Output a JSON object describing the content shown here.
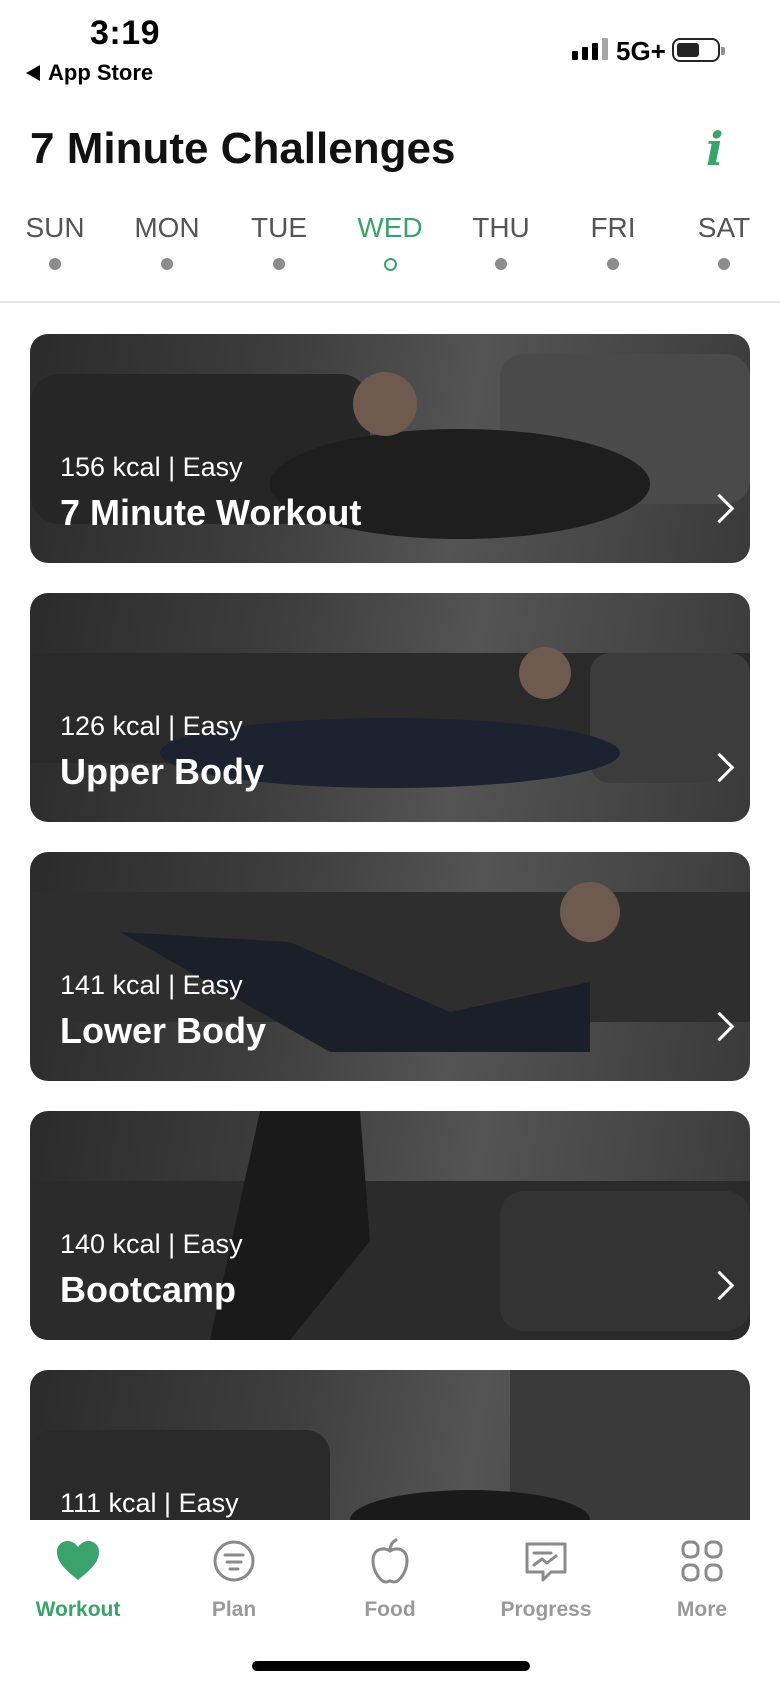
{
  "status_bar": {
    "time": "3:19",
    "back_label": "App Store",
    "network": "5G+"
  },
  "header": {
    "title": "7 Minute Challenges",
    "info_glyph": "i"
  },
  "days": [
    {
      "label": "SUN",
      "active": false
    },
    {
      "label": "MON",
      "active": false
    },
    {
      "label": "TUE",
      "active": false
    },
    {
      "label": "WED",
      "active": true
    },
    {
      "label": "THU",
      "active": false
    },
    {
      "label": "FRI",
      "active": false
    },
    {
      "label": "SAT",
      "active": false
    }
  ],
  "workouts": [
    {
      "meta": "156 kcal | Easy",
      "name": "7 Minute Workout"
    },
    {
      "meta": "126 kcal | Easy",
      "name": "Upper Body"
    },
    {
      "meta": "141 kcal | Easy",
      "name": "Lower Body"
    },
    {
      "meta": "140 kcal | Easy",
      "name": "Bootcamp"
    },
    {
      "meta": "111 kcal | Easy",
      "name": ""
    }
  ],
  "tabs": [
    {
      "label": "Workout",
      "icon": "heart-icon",
      "active": true
    },
    {
      "label": "Plan",
      "icon": "plan-icon",
      "active": false
    },
    {
      "label": "Food",
      "icon": "apple-icon",
      "active": false
    },
    {
      "label": "Progress",
      "icon": "progress-icon",
      "active": false
    },
    {
      "label": "More",
      "icon": "grid-icon",
      "active": false
    }
  ],
  "colors": {
    "accent": "#3aa36b",
    "inactive": "#9a9a9a"
  }
}
